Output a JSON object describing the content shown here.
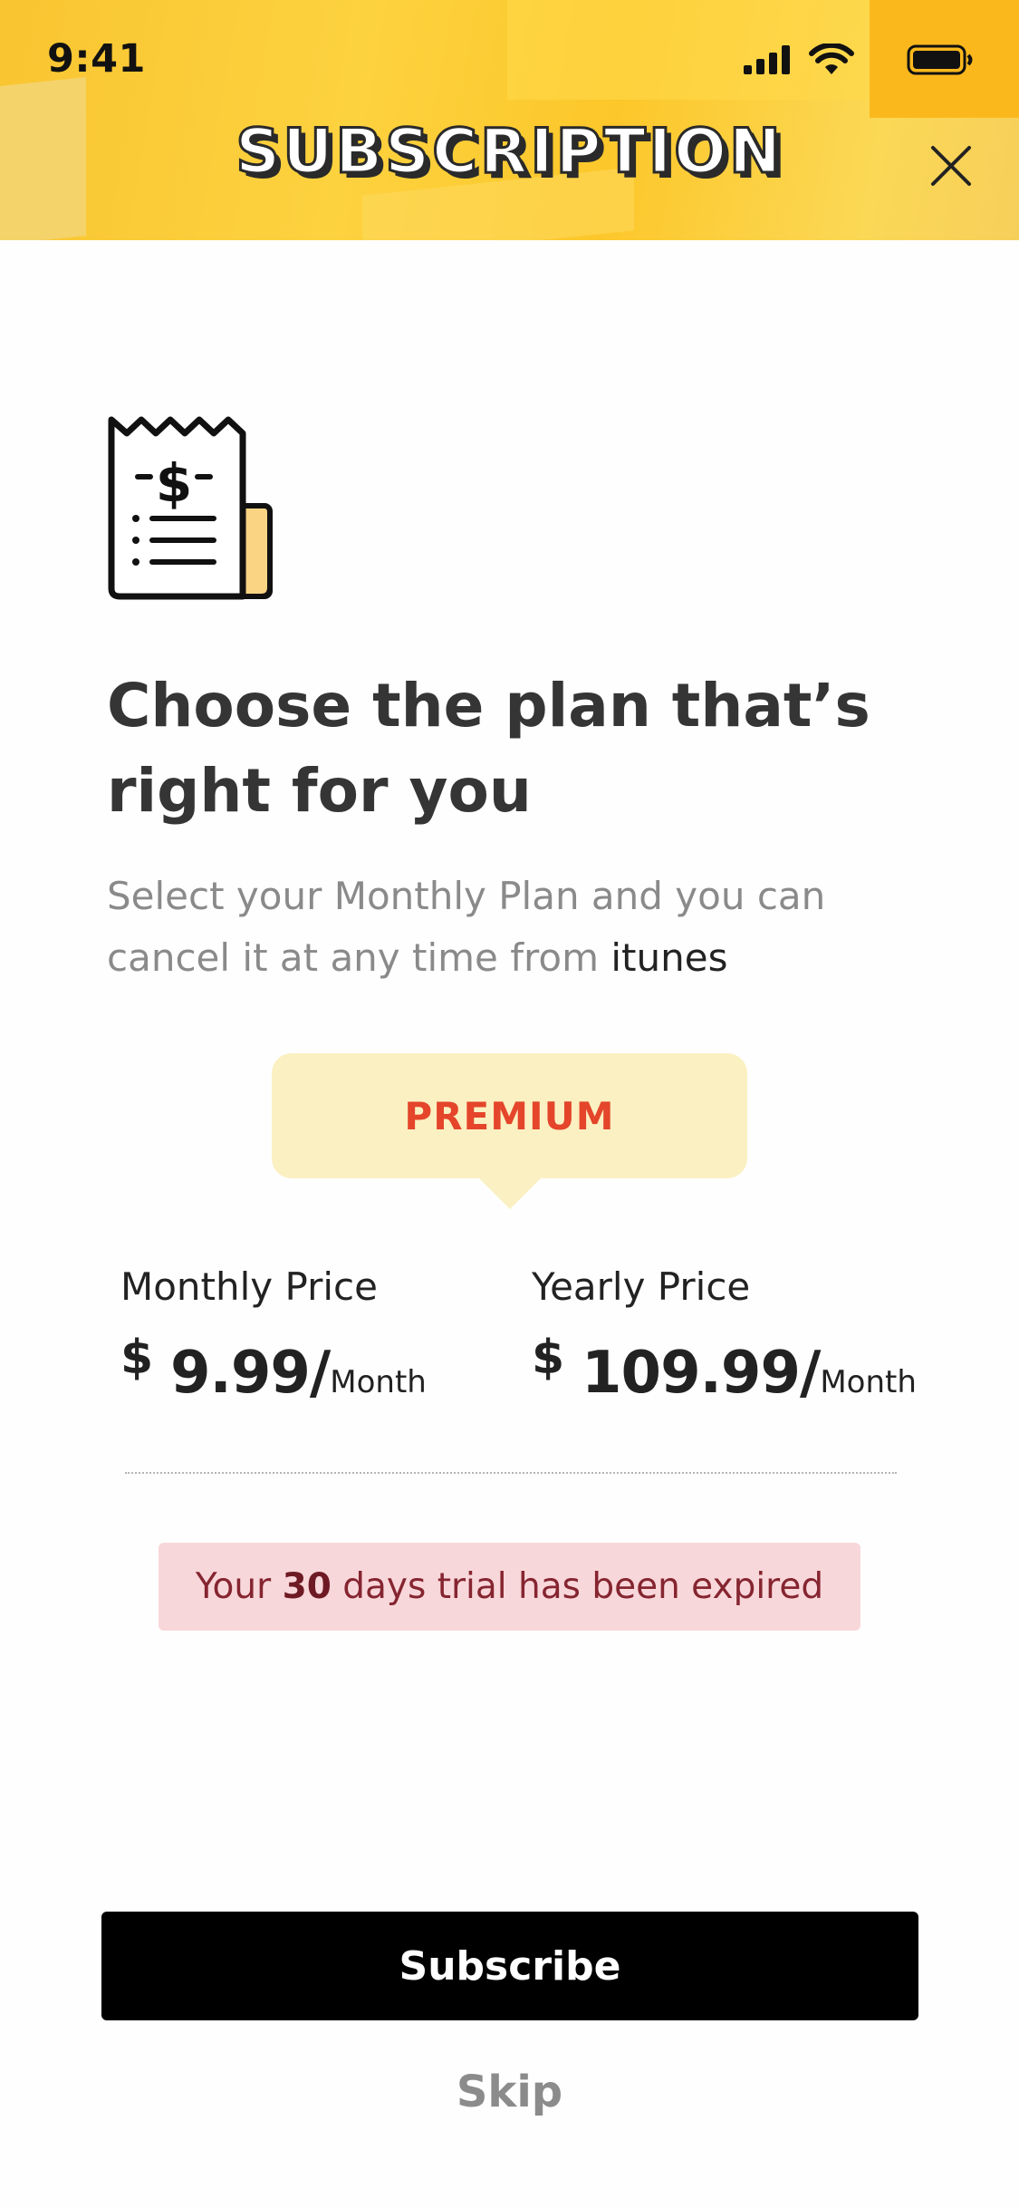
{
  "status_bar": {
    "time": "9:41",
    "icons": [
      "cellular-signal-icon",
      "wifi-icon",
      "battery-icon"
    ]
  },
  "header": {
    "title": "SUBSCRIPTION",
    "close_icon": "close-icon",
    "colors": {
      "background": "#fcc72a",
      "title_outline": "#2a2a2a"
    }
  },
  "hero": {
    "icon": "receipt-dollar-icon",
    "title": "Choose the plan that’s right for you",
    "subtitle_lead": "Select your Monthly Plan and you can cancel it at any time from",
    "subtitle_highlight": "itunes"
  },
  "plan": {
    "name": "PREMIUM",
    "colors": {
      "bubble": "#fbf0c2",
      "text": "#e4452b"
    }
  },
  "prices": {
    "monthly": {
      "label": "Monthly Price",
      "currency": "$",
      "amount": "9.99/",
      "period": "Month"
    },
    "yearly": {
      "label": "Yearly Price",
      "currency": "$",
      "amount": "109.99/",
      "period": "Month"
    }
  },
  "trial_notice": {
    "before": "Your",
    "days": "30",
    "after": "days trial has been expired",
    "colors": {
      "background": "#f8d7da",
      "text": "#852530"
    }
  },
  "actions": {
    "subscribe_label": "Subscribe",
    "skip_label": "Skip"
  }
}
